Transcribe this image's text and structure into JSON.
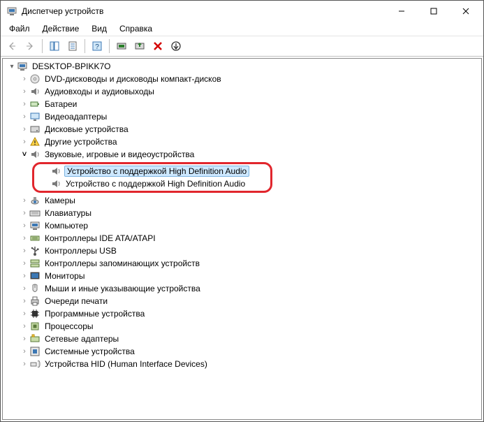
{
  "window": {
    "title": "Диспетчер устройств"
  },
  "menu": {
    "file": "Файл",
    "action": "Действие",
    "view": "Вид",
    "help": "Справка"
  },
  "tree": {
    "root": "DESKTOP-BPIKK7O",
    "items": [
      {
        "label": "DVD-дисководы и дисководы компакт-дисков",
        "icon": "disc"
      },
      {
        "label": "Аудиовходы и аудиовыходы",
        "icon": "speaker"
      },
      {
        "label": "Батареи",
        "icon": "battery"
      },
      {
        "label": "Видеоадаптеры",
        "icon": "display"
      },
      {
        "label": "Дисковые устройства",
        "icon": "drive"
      },
      {
        "label": "Другие устройства",
        "icon": "warn"
      },
      {
        "label": "Звуковые, игровые и видеоустройства",
        "icon": "speaker",
        "expanded": true
      },
      {
        "label": "Камеры",
        "icon": "camera"
      },
      {
        "label": "Клавиатуры",
        "icon": "keyboard"
      },
      {
        "label": "Компьютер",
        "icon": "computer"
      },
      {
        "label": "Контроллеры IDE ATA/ATAPI",
        "icon": "ide"
      },
      {
        "label": "Контроллеры USB",
        "icon": "usb"
      },
      {
        "label": "Контроллеры запоминающих устройств",
        "icon": "storage"
      },
      {
        "label": "Мониторы",
        "icon": "monitor"
      },
      {
        "label": "Мыши и иные указывающие устройства",
        "icon": "mouse"
      },
      {
        "label": "Очереди печати",
        "icon": "printer"
      },
      {
        "label": "Программные устройства",
        "icon": "chip"
      },
      {
        "label": "Процессоры",
        "icon": "cpu"
      },
      {
        "label": "Сетевые адаптеры",
        "icon": "network"
      },
      {
        "label": "Системные устройства",
        "icon": "system"
      },
      {
        "label": "Устройства HID (Human Interface Devices)",
        "icon": "hid"
      }
    ],
    "sound_children": [
      "Устройство с поддержкой High Definition Audio",
      "Устройство с поддержкой High Definition Audio"
    ]
  },
  "callout_color": "#e1262d"
}
